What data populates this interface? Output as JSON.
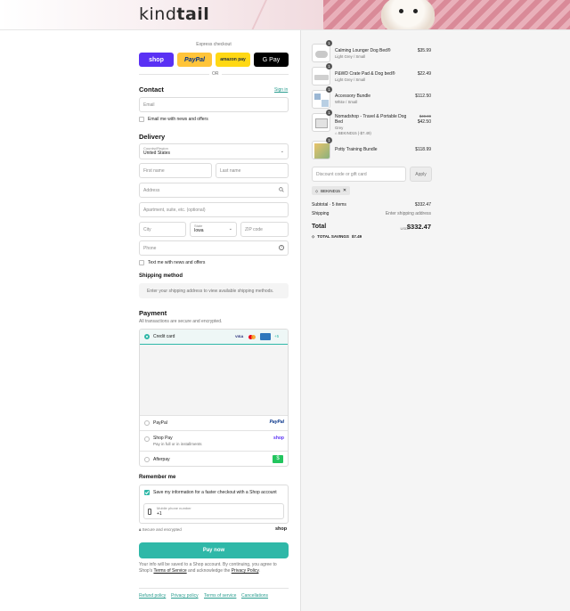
{
  "header": {
    "logo_part1": "kind",
    "logo_part2": "tail"
  },
  "express": {
    "label": "Express checkout",
    "buttons": [
      {
        "label": "shop",
        "color": "#5a31f4"
      },
      {
        "label": "PayPal",
        "color": "#ffc439"
      },
      {
        "label": "amazon pay",
        "color": "#ffd814"
      },
      {
        "label": "G Pay",
        "color": "#000000"
      }
    ],
    "or": "OR"
  },
  "contact": {
    "title": "Contact",
    "sign_in": "Sign in",
    "email_placeholder": "Email",
    "news_label": "Email me with news and offers"
  },
  "delivery": {
    "title": "Delivery",
    "country_label": "Country/Region",
    "country_value": "United States",
    "first_name": "First name",
    "last_name": "Last name",
    "address": "Address",
    "apartment": "Apartment, suite, etc. (optional)",
    "city": "City",
    "state_label": "State",
    "state_value": "Iowa",
    "zip": "ZIP code",
    "phone": "Phone",
    "text_label": "Text me with news and offers"
  },
  "shipping": {
    "title": "Shipping method",
    "notice": "Enter your shipping address to view available shipping methods."
  },
  "payment": {
    "title": "Payment",
    "subtitle": "All transactions are secure and encrypted.",
    "credit_card": "Credit card",
    "card_more": "+5",
    "paypal": "PayPal",
    "paypal_logo": "PayPal",
    "shop_pay": "Shop Pay",
    "shop_pay_sub": "Pay in full or in installments",
    "shop_logo": "shop",
    "afterpay": "Afterpay"
  },
  "remember": {
    "title": "Remember me",
    "save_label": "Save my information for a faster checkout with a Shop account",
    "mobile_label": "Mobile phone number",
    "mobile_value": "+1",
    "secure": "Secure and encrypted",
    "shop": "shop"
  },
  "pay_now": "Pay now",
  "fineprint": {
    "text1": "Your info will be saved to a Shop account. By continuing, you agree to Shop's ",
    "terms": "Terms of Service",
    "text2": " and acknowledge the ",
    "privacy": "Privacy Policy",
    "text3": "."
  },
  "footer_links": [
    "Refund policy",
    "Privacy policy",
    "Terms of service",
    "Cancellations"
  ],
  "cart": {
    "items": [
      {
        "qty": "1",
        "name": "Calming Lounger Dog Bed®",
        "variant": "Light Grey / Small",
        "price": "$35.99"
      },
      {
        "qty": "1",
        "name": "P&WD Crate Pad & Dog bed®",
        "variant": "Light Grey / Small",
        "price": "$22.49"
      },
      {
        "qty": "1",
        "name": "Accessory Bundle",
        "variant": "White / Small",
        "price": "$112.50"
      },
      {
        "qty": "1",
        "name": "Nomadshop - Travel & Portable Dog Bed",
        "variant": "Grey",
        "discount": "BEKIND15 (-$7.49)",
        "old_price": "$49.99",
        "price": "$42.50"
      },
      {
        "qty": "1",
        "name": "Potty Training Bundle",
        "variant": "",
        "price": "$118.99"
      }
    ],
    "discount_placeholder": "Discount code or gift card",
    "apply": "Apply",
    "code_tag": "BEKIND15",
    "subtotal_label": "Subtotal · 5 items",
    "subtotal_value": "$332.47",
    "shipping_label": "Shipping",
    "shipping_value": "Enter shipping address",
    "total_label": "Total",
    "currency": "USD",
    "total_value": "$332.47",
    "savings_label": "TOTAL SAVINGS",
    "savings_value": "$7.49"
  }
}
